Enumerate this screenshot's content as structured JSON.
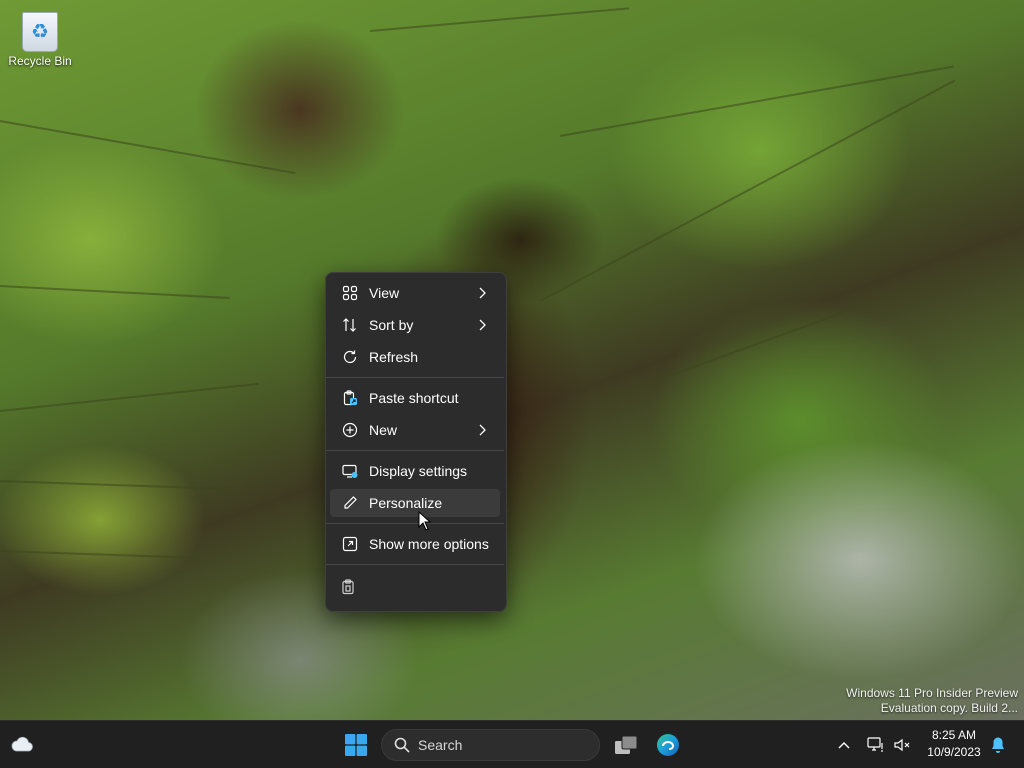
{
  "desktop": {
    "icons": [
      {
        "label": "Recycle Bin",
        "icon": "recycle-bin-icon"
      }
    ],
    "watermark": {
      "line1": "Windows 11 Pro Insider Preview",
      "line2": "Evaluation copy. Build 2..."
    }
  },
  "context_menu": {
    "items": [
      {
        "label": "View",
        "icon": "grid-view-icon",
        "submenu": true
      },
      {
        "label": "Sort by",
        "icon": "sort-icon",
        "submenu": true
      },
      {
        "label": "Refresh",
        "icon": "refresh-icon",
        "submenu": false
      },
      {
        "label": "Paste shortcut",
        "icon": "paste-shortcut-icon",
        "submenu": false
      },
      {
        "label": "New",
        "icon": "new-plus-icon",
        "submenu": true
      },
      {
        "label": "Display settings",
        "icon": "display-settings-icon",
        "submenu": false
      },
      {
        "label": "Personalize",
        "icon": "pencil-icon",
        "submenu": false,
        "hovered": true
      },
      {
        "label": "Show more options",
        "icon": "open-external-icon",
        "submenu": false
      }
    ],
    "bottom_icons": [
      "paste-icon"
    ]
  },
  "taskbar": {
    "search_placeholder": "Search",
    "pinned": [
      "start-icon",
      "search-icon",
      "task-view-icon",
      "edge-icon"
    ],
    "tray": {
      "time": "8:25 AM",
      "date": "10/9/2023"
    }
  },
  "colors": {
    "menu_bg": "#2c2c2c",
    "menu_hover": "#3b3b3b",
    "taskbar_bg": "#202020",
    "accent": "#4cc2ff"
  }
}
